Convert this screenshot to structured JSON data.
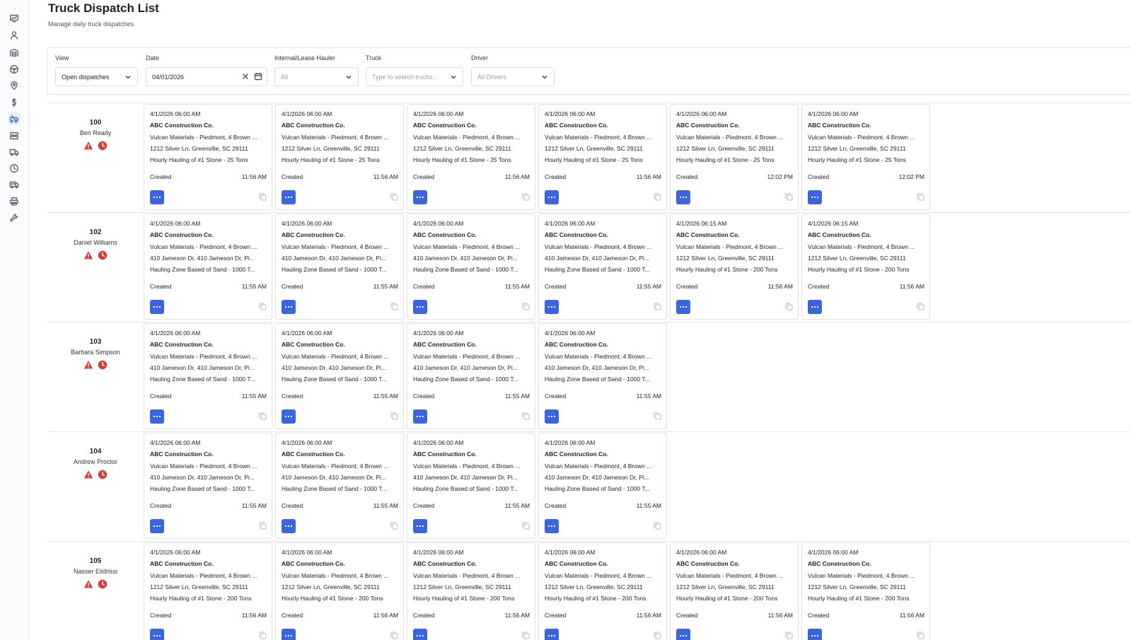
{
  "page": {
    "title": "Truck Dispatch List",
    "subtitle": "Manage daily truck dispatches"
  },
  "sidebar": {
    "icons": [
      "dashboard-icon",
      "user-icon",
      "warehouse-icon",
      "steering-wheel-icon",
      "location-pin-icon",
      "dollar-icon",
      "dispatch-icon",
      "server-icon",
      "truck-icon",
      "clock-icon",
      "delivery-truck-icon",
      "printer-icon",
      "wrench-icon"
    ],
    "active": "dispatch-icon"
  },
  "filters": {
    "view": {
      "label": "View",
      "value": "Open dispatches"
    },
    "date": {
      "label": "Date",
      "value": "04/01/2026"
    },
    "hauler": {
      "label": "Internal/Lease Hauler",
      "value": "All"
    },
    "truck": {
      "label": "Truck",
      "placeholder": "Type to search trucks..."
    },
    "driver": {
      "label": "Driver",
      "value": "All Drivers"
    }
  },
  "colors": {
    "accent": "#3b64e0",
    "warning": "#d93b3b"
  },
  "trucks": [
    {
      "number": "100",
      "driver": "Ben Ready",
      "status_icons": [
        "warning-icon",
        "clock-alert-icon"
      ],
      "dispatches": [
        {
          "datetime": "4/1/2026 06:00 AM",
          "customer": "ABC Construction Co.",
          "origin": "Vulcan Materials - Piedmont, 4 Brown ...",
          "destination": "1212 Silver Ln, Greenville, SC 29111",
          "job": "Hourly Hauling of #1 Stone - 25 Tons",
          "status": "Created",
          "time": "11:56 AM"
        },
        {
          "datetime": "4/1/2026 06:00 AM",
          "customer": "ABC Construction Co.",
          "origin": "Vulcan Materials - Piedmont, 4 Brown ...",
          "destination": "1212 Silver Ln, Greenville, SC 29111",
          "job": "Hourly Hauling of #1 Stone - 25 Tons",
          "status": "Created",
          "time": "11:56 AM"
        },
        {
          "datetime": "4/1/2026 06:00 AM",
          "customer": "ABC Construction Co.",
          "origin": "Vulcan Materials - Piedmont, 4 Brown ...",
          "destination": "1212 Silver Ln, Greenville, SC 29111",
          "job": "Hourly Hauling of #1 Stone - 25 Tons",
          "status": "Created",
          "time": "11:56 AM"
        },
        {
          "datetime": "4/1/2026 06:00 AM",
          "customer": "ABC Construction Co.",
          "origin": "Vulcan Materials - Piedmont, 4 Brown ...",
          "destination": "1212 Silver Ln, Greenville, SC 29111",
          "job": "Hourly Hauling of #1 Stone - 25 Tons",
          "status": "Created",
          "time": "11:56 AM"
        },
        {
          "datetime": "4/1/2026 06:00 AM",
          "customer": "ABC Construction Co.",
          "origin": "Vulcan Materials - Piedmont, 4 Brown ...",
          "destination": "1212 Silver Ln, Greenville, SC 29111",
          "job": "Hourly Hauling of #1 Stone - 25 Tons",
          "status": "Created",
          "time": "12:02 PM"
        },
        {
          "datetime": "4/1/2026 06:00 AM",
          "customer": "ABC Construction Co.",
          "origin": "Vulcan Materials - Piedmont, 4 Brown ...",
          "destination": "1212 Silver Ln, Greenville, SC 29111",
          "job": "Hourly Hauling of #1 Stone - 25 Tons",
          "status": "Created",
          "time": "12:02 PM"
        }
      ]
    },
    {
      "number": "102",
      "driver": "Daniel Williams",
      "status_icons": [
        "warning-icon",
        "clock-alert-icon"
      ],
      "dispatches": [
        {
          "datetime": "4/1/2026 06:00 AM",
          "customer": "ABC Construction Co.",
          "origin": "Vulcan Materials - Piedmont, 4 Brown ...",
          "destination": "410 Jameson Dr, 410 Jameson Dr, Pi...",
          "job": "Hauling Zone Based of Sand - 1000 T...",
          "status": "Created",
          "time": "11:55 AM"
        },
        {
          "datetime": "4/1/2026 06:00 AM",
          "customer": "ABC Construction Co.",
          "origin": "Vulcan Materials - Piedmont, 4 Brown ...",
          "destination": "410 Jameson Dr, 410 Jameson Dr, Pi...",
          "job": "Hauling Zone Based of Sand - 1000 T...",
          "status": "Created",
          "time": "11:55 AM"
        },
        {
          "datetime": "4/1/2026 06:00 AM",
          "customer": "ABC Construction Co.",
          "origin": "Vulcan Materials - Piedmont, 4 Brown ...",
          "destination": "410 Jameson Dr, 410 Jameson Dr, Pi...",
          "job": "Hauling Zone Based of Sand - 1000 T...",
          "status": "Created",
          "time": "11:55 AM"
        },
        {
          "datetime": "4/1/2026 06:00 AM",
          "customer": "ABC Construction Co.",
          "origin": "Vulcan Materials - Piedmont, 4 Brown ...",
          "destination": "410 Jameson Dr, 410 Jameson Dr, Pi...",
          "job": "Hauling Zone Based of Sand - 1000 T...",
          "status": "Created",
          "time": "11:55 AM"
        },
        {
          "datetime": "4/1/2026 06:15 AM",
          "customer": "ABC Construction Co.",
          "origin": "Vulcan Materials - Piedmont, 4 Brown ...",
          "destination": "1212 Silver Ln, Greenville, SC 29111",
          "job": "Hourly Hauling of #1 Stone - 200 Tons",
          "status": "Created",
          "time": "11:56 AM"
        },
        {
          "datetime": "4/1/2026 06:15 AM",
          "customer": "ABC Construction Co.",
          "origin": "Vulcan Materials - Piedmont, 4 Brown ...",
          "destination": "1212 Silver Ln, Greenville, SC 29111",
          "job": "Hourly Hauling of #1 Stone - 200 Tons",
          "status": "Created",
          "time": "11:56 AM"
        }
      ]
    },
    {
      "number": "103",
      "driver": "Barbara Simpson",
      "status_icons": [
        "warning-icon",
        "clock-alert-icon"
      ],
      "dispatches": [
        {
          "datetime": "4/1/2026 06:00 AM",
          "customer": "ABC Construction Co.",
          "origin": "Vulcan Materials - Piedmont, 4 Brown ...",
          "destination": "410 Jameson Dr, 410 Jameson Dr, Pi...",
          "job": "Hauling Zone Based of Sand - 1000 T...",
          "status": "Created",
          "time": "11:55 AM"
        },
        {
          "datetime": "4/1/2026 06:00 AM",
          "customer": "ABC Construction Co.",
          "origin": "Vulcan Materials - Piedmont, 4 Brown ...",
          "destination": "410 Jameson Dr, 410 Jameson Dr, Pi...",
          "job": "Hauling Zone Based of Sand - 1000 T...",
          "status": "Created",
          "time": "11:55 AM"
        },
        {
          "datetime": "4/1/2026 06:00 AM",
          "customer": "ABC Construction Co.",
          "origin": "Vulcan Materials - Piedmont, 4 Brown ...",
          "destination": "410 Jameson Dr, 410 Jameson Dr, Pi...",
          "job": "Hauling Zone Based of Sand - 1000 T...",
          "status": "Created",
          "time": "11:55 AM"
        },
        {
          "datetime": "4/1/2026 06:00 AM",
          "customer": "ABC Construction Co.",
          "origin": "Vulcan Materials - Piedmont, 4 Brown ...",
          "destination": "410 Jameson Dr, 410 Jameson Dr, Pi...",
          "job": "Hauling Zone Based of Sand - 1000 T...",
          "status": "Created",
          "time": "11:55 AM"
        }
      ]
    },
    {
      "number": "104",
      "driver": "Andrew Proctor",
      "status_icons": [
        "warning-icon",
        "clock-alert-icon"
      ],
      "dispatches": [
        {
          "datetime": "4/1/2026 06:00 AM",
          "customer": "ABC Construction Co.",
          "origin": "Vulcan Materials - Piedmont, 4 Brown ...",
          "destination": "410 Jameson Dr, 410 Jameson Dr, Pi...",
          "job": "Hauling Zone Based of Sand - 1000 T...",
          "status": "Created",
          "time": "11:55 AM"
        },
        {
          "datetime": "4/1/2026 06:00 AM",
          "customer": "ABC Construction Co.",
          "origin": "Vulcan Materials - Piedmont, 4 Brown ...",
          "destination": "410 Jameson Dr, 410 Jameson Dr, Pi...",
          "job": "Hauling Zone Based of Sand - 1000 T...",
          "status": "Created",
          "time": "11:55 AM"
        },
        {
          "datetime": "4/1/2026 06:00 AM",
          "customer": "ABC Construction Co.",
          "origin": "Vulcan Materials - Piedmont, 4 Brown ...",
          "destination": "410 Jameson Dr, 410 Jameson Dr, Pi...",
          "job": "Hauling Zone Based of Sand - 1000 T...",
          "status": "Created",
          "time": "11:55 AM"
        },
        {
          "datetime": "4/1/2026 06:00 AM",
          "customer": "ABC Construction Co.",
          "origin": "Vulcan Materials - Piedmont, 4 Brown ...",
          "destination": "410 Jameson Dr, 410 Jameson Dr, Pi...",
          "job": "Hauling Zone Based of Sand - 1000 T...",
          "status": "Created",
          "time": "11:55 AM"
        }
      ]
    },
    {
      "number": "105",
      "driver": "Nasser Elidrissi",
      "status_icons": [
        "warning-icon",
        "clock-alert-icon"
      ],
      "dispatches": [
        {
          "datetime": "4/1/2026 06:00 AM",
          "customer": "ABC Construction Co.",
          "origin": "Vulcan Materials - Piedmont, 4 Brown ...",
          "destination": "1212 Silver Ln, Greenville, SC 29111",
          "job": "Hourly Hauling of #1 Stone - 200 Tons",
          "status": "Created",
          "time": "11:56 AM"
        },
        {
          "datetime": "4/1/2026 06:00 AM",
          "customer": "ABC Construction Co.",
          "origin": "Vulcan Materials - Piedmont, 4 Brown ...",
          "destination": "1212 Silver Ln, Greenville, SC 29111",
          "job": "Hourly Hauling of #1 Stone - 200 Tons",
          "status": "Created",
          "time": "11:56 AM"
        },
        {
          "datetime": "4/1/2026 06:00 AM",
          "customer": "ABC Construction Co.",
          "origin": "Vulcan Materials - Piedmont, 4 Brown ...",
          "destination": "1212 Silver Ln, Greenville, SC 29111",
          "job": "Hourly Hauling of #1 Stone - 200 Tons",
          "status": "Created",
          "time": "11:56 AM"
        },
        {
          "datetime": "4/1/2026 06:00 AM",
          "customer": "ABC Construction Co.",
          "origin": "Vulcan Materials - Piedmont, 4 Brown ...",
          "destination": "1212 Silver Ln, Greenville, SC 29111",
          "job": "Hourly Hauling of #1 Stone - 200 Tons",
          "status": "Created",
          "time": "11:56 AM"
        },
        {
          "datetime": "4/1/2026 06:00 AM",
          "customer": "ABC Construction Co.",
          "origin": "Vulcan Materials - Piedmont, 4 Brown ...",
          "destination": "1212 Silver Ln, Greenville, SC 29111",
          "job": "Hourly Hauling of #1 Stone - 200 Tons",
          "status": "Created",
          "time": "11:56 AM"
        },
        {
          "datetime": "4/1/2026 06:00 AM",
          "customer": "ABC Construction Co.",
          "origin": "Vulcan Materials - Piedmont, 4 Brown ...",
          "destination": "1212 Silver Ln, Greenville, SC 29111",
          "job": "Hourly Hauling of #1 Stone - 200 Tons",
          "status": "Created",
          "time": "11:56 AM"
        }
      ]
    }
  ]
}
